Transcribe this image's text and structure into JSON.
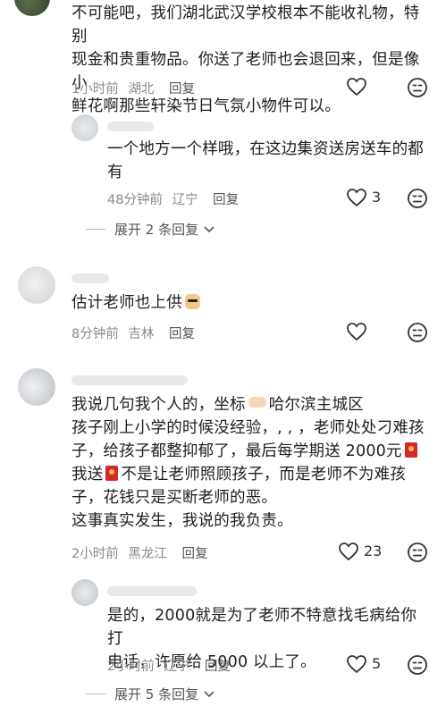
{
  "comments": [
    {
      "text_lines": [
        "不可能吧，我们湖北武汉学校根本不能收礼物，特别",
        "现金和贵重物品。你送了老师也会退回来，但是像小",
        "鲜花啊那些轩染节日气氛小物件可以。"
      ],
      "time": "1小时前",
      "location": "湖北",
      "reply_label": "回复",
      "like_icon": "heart-outline-icon",
      "reply_thread": {
        "text_lines": [
          "一个地方一个样哦，在这边集资送房送车的都",
          "有"
        ],
        "time": "48分钟前",
        "location": "辽宁",
        "reply_label": "回复",
        "like_count": "3",
        "expand_label": "展开 2 条回复"
      }
    },
    {
      "text": "估计老师也上供",
      "time": "8分钟前",
      "location": "吉林",
      "reply_label": "回复"
    },
    {
      "text_lines": [
        "我说几句我个人的，坐标",
        "哈尔滨主城区",
        "孩子刚上小学的时候没经验，, , ，老师处处刁难孩",
        "子，给孩子都整抑郁了，最后每学期送 2000元",
        "我送",
        "不是让老师照顾孩子，而是老师不为难孩",
        "子，花钱只是买断老师的恶。",
        "这事真实发生，我说的我负责。"
      ],
      "time": "2小时前",
      "location": "黑龙江",
      "reply_label": "回复",
      "like_count": "23",
      "reply_thread": {
        "text_lines": [
          "是的，2000就是为了老师不特意找毛病给你打",
          "电话，许愿给 5000 以上了。"
        ],
        "time": "2小时前",
        "location": "辽宁",
        "reply_label": "回复",
        "like_count": "5",
        "expand_label": "展开 5 条回复"
      }
    }
  ],
  "colors": {
    "text": "#1e1e1e",
    "meta": "#8a8a8a",
    "redpacket": "#d7262b"
  }
}
